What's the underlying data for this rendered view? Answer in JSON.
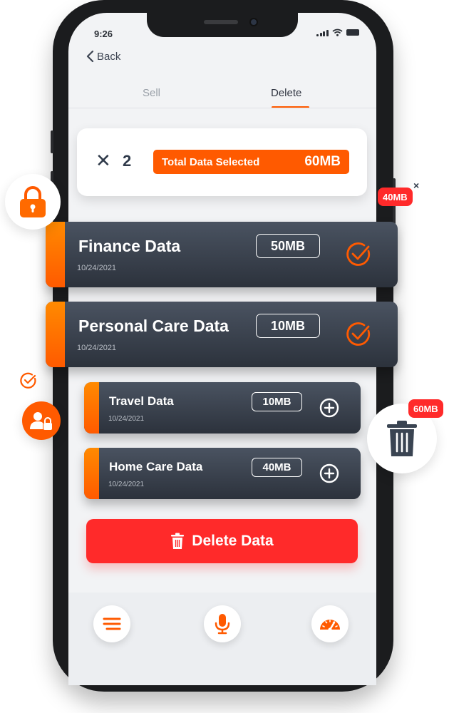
{
  "status": {
    "time": "9:26"
  },
  "nav": {
    "back_label": "Back"
  },
  "tabs": [
    {
      "label": "Sell",
      "active": false
    },
    {
      "label": "Delete",
      "active": true
    }
  ],
  "selection": {
    "close_symbol": "✕",
    "count": "2",
    "total_label": "Total Data Selected",
    "total_value": "60MB"
  },
  "data_items": [
    {
      "title": "Finance Data",
      "date": "10/24/2021",
      "size": "50MB",
      "selected": true
    },
    {
      "title": "Personal Care Data",
      "date": "10/24/2021",
      "size": "10MB",
      "selected": true
    },
    {
      "title": "Travel Data",
      "date": "10/24/2021",
      "size": "10MB",
      "selected": false
    },
    {
      "title": "Home Care Data",
      "date": "10/24/2021",
      "size": "40MB",
      "selected": false
    }
  ],
  "delete_button": {
    "label": "Delete Data"
  },
  "bottom_nav": [
    {
      "icon": "menu-icon"
    },
    {
      "icon": "microphone-icon"
    },
    {
      "icon": "speedometer-icon"
    }
  ],
  "floating": {
    "badge_top": "40MB",
    "badge_trash": "60MB"
  },
  "colors": {
    "accent": "#ff5a00",
    "danger": "#ff2a2a",
    "card_dark": "#2c323c"
  }
}
